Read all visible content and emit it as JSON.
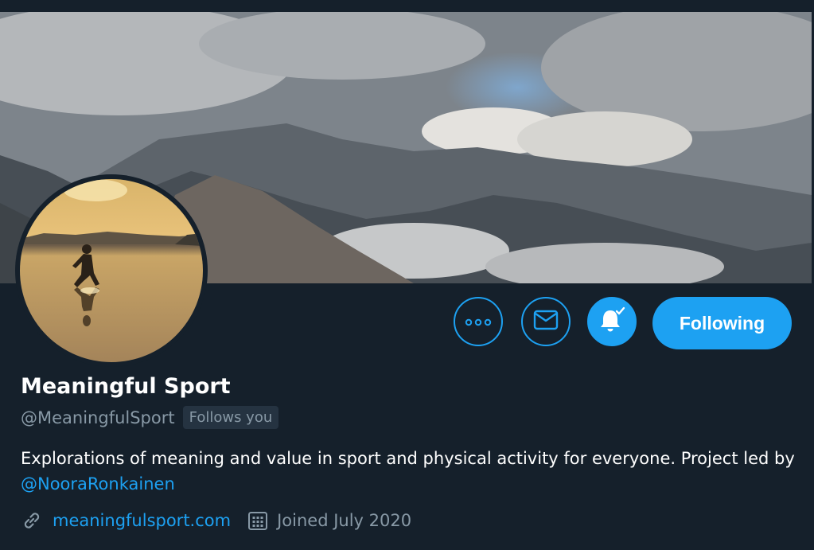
{
  "profile": {
    "display_name": "Meaningful Sport",
    "handle": "@MeaningfulSport",
    "follows_you_badge": "Follows you",
    "bio_text": "Explorations of meaning and value in sport and physical activity for everyone. Project led by ",
    "bio_mention": "@NooraRonkainen",
    "website": "meaningfulsport.com",
    "joined": "Joined July 2020"
  },
  "actions": {
    "following_label": "Following",
    "more_icon": "more-horizontal-icon",
    "message_icon": "envelope-icon",
    "notifications_icon": "bell-check-icon"
  },
  "theme": {
    "background": "#15202b",
    "accent": "#1da1f2",
    "secondary_text": "#8899a6",
    "badge_background": "#253341"
  }
}
